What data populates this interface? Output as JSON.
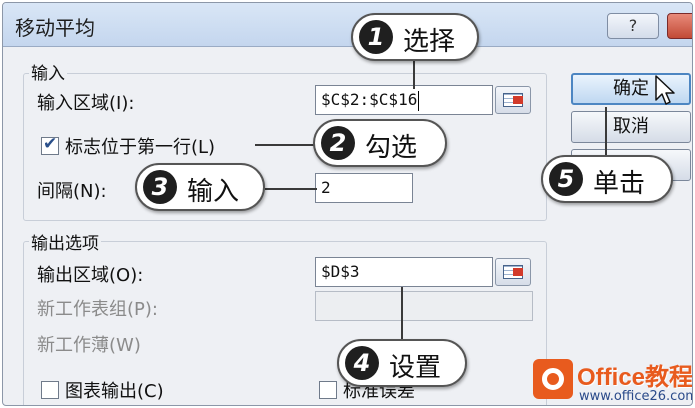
{
  "dialog": {
    "title": "移动平均",
    "help_label": "?"
  },
  "input_group": {
    "title": "输入",
    "range_label": "输入区域(I):",
    "range_value": "$C$2:$C$16",
    "first_row_label": "标志位于第一行(L)",
    "first_row_checked": true,
    "interval_label": "间隔(N):",
    "interval_value": "2"
  },
  "output_group": {
    "title": "输出选项",
    "range_label": "输出区域(O):",
    "range_value": "$D$3",
    "new_sheet_label": "新工作表组(P):",
    "new_workbook_label": "新工作薄(W)",
    "chart_output_label": "图表输出(C)",
    "std_error_label": "标准误差"
  },
  "buttons": {
    "ok": "确定",
    "cancel": "取消"
  },
  "callouts": [
    {
      "num": "1",
      "text": "选择"
    },
    {
      "num": "2",
      "text": "勾选"
    },
    {
      "num": "3",
      "text": "输入"
    },
    {
      "num": "4",
      "text": "设置"
    },
    {
      "num": "5",
      "text": "单击"
    }
  ],
  "watermark": {
    "title": "Office教程网",
    "url": "www.office26.com"
  },
  "colors": {
    "default_button_border": "#4d86c2",
    "watermark_orange": "#e85b1e",
    "callout_badge": "#1f1f1f"
  }
}
